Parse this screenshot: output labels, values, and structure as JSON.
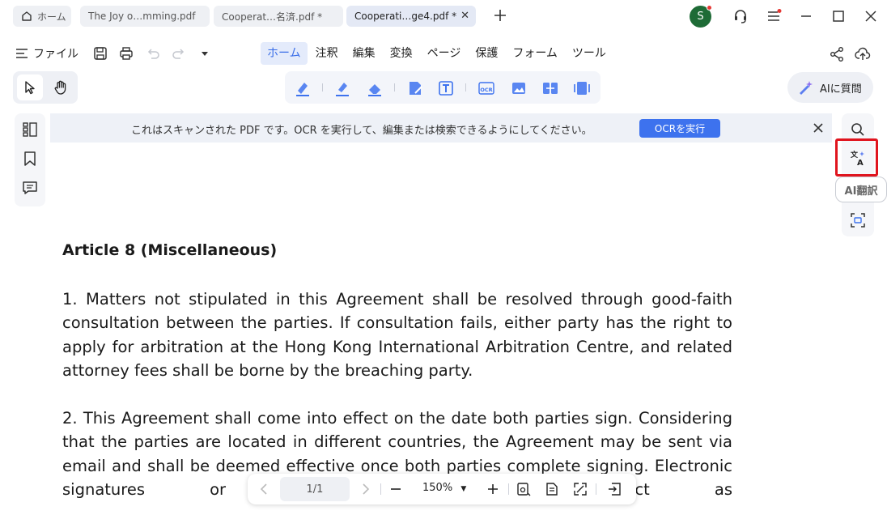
{
  "tabs": [
    {
      "label": "ホーム",
      "icon": "home-icon"
    },
    {
      "label": "The Joy o…mming.pdf"
    },
    {
      "label": "Cooperat…名済.pdf *"
    },
    {
      "label": "Cooperati…ge4.pdf *",
      "active": true
    }
  ],
  "avatar": {
    "initial": "S",
    "color": "#1e6b36"
  },
  "menu": {
    "file_label": "ファイル",
    "tabs": [
      "ホーム",
      "注釈",
      "編集",
      "変換",
      "ページ",
      "保護",
      "フォーム",
      "ツール"
    ],
    "active_tab": "ホーム"
  },
  "ai_ask": {
    "label": "AIに質問"
  },
  "banner": {
    "text": "これはスキャンされた PDF です。OCR を実行して、編集または検索できるようにしてください。",
    "button": "OCRを実行"
  },
  "right_rail": {
    "translate_tooltip": "AI翻訳"
  },
  "document": {
    "heading": "Article 8 (Miscellaneous)",
    "para1_lines": [
      "1. Matters not stipulated in this Agreement shall be resolved through good-faith",
      "consultation between the parties. If consultation fails, either party has the right to",
      "apply for arbitration at the Hong Kong International Arbitration Centre, and related",
      "attorney fees shall be borne by the breaching party."
    ],
    "para2_lines": [
      "2. This Agreement shall come into effect on the date both parties sign. Considering",
      "that the parties are located in different countries, the Agreement may be sent via",
      "email and shall be deemed effective once both parties complete signing. Electronic",
      "signatures or scanned ... legal effect as"
    ]
  },
  "bottom_bar": {
    "page": "1/1",
    "zoom": "150%"
  },
  "colors": {
    "accent": "#3d72ee",
    "highlight": "#e0141e"
  }
}
